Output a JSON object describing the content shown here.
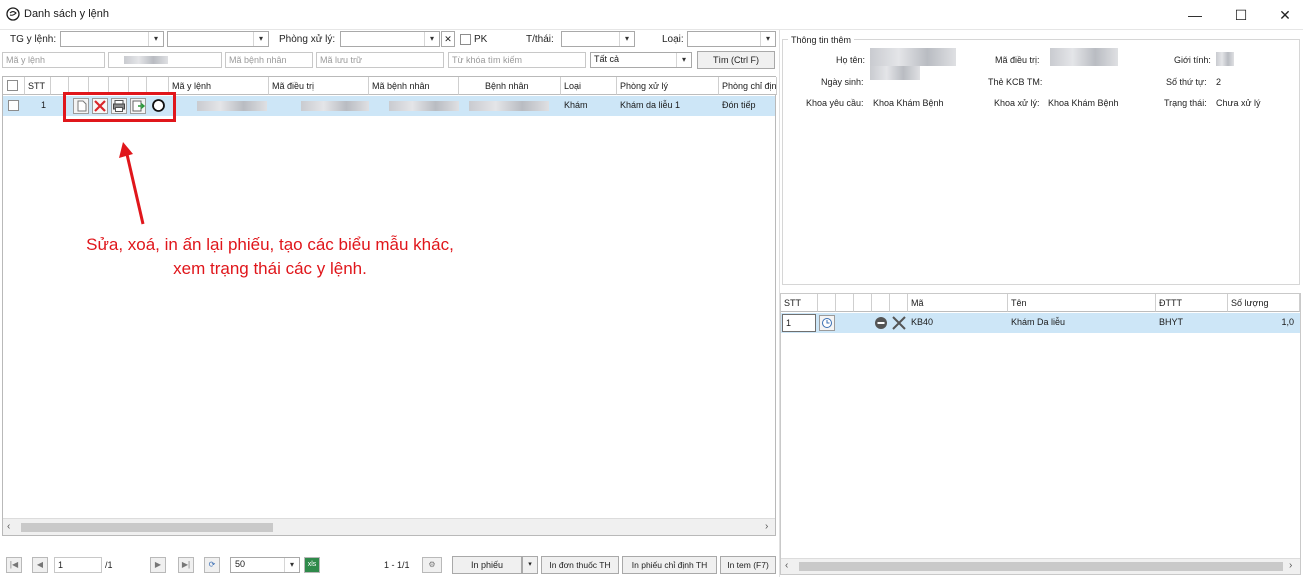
{
  "window": {
    "title": "Danh sách y lệnh",
    "minimize_glyph": "—",
    "maximize_glyph": "☐",
    "close_glyph": "✕"
  },
  "filters": {
    "tg_label": "TG y lệnh:",
    "phong_label": "Phòng xử lý:",
    "pk_label": "PK",
    "tthai_label": "T/thái:",
    "loai_label": "Loại:",
    "clear_glyph": "✕",
    "search_row": {
      "ma_y_lenh": "Mã y lệnh",
      "ma_benh_nhan": "Mã bệnh nhân",
      "ma_luu_tru": "Mã lưu trữ",
      "tu_khoa": "Từ khóa tìm kiếm",
      "status_select": "Tất cả",
      "find_button": "Tìm (Ctrl F)"
    }
  },
  "main_grid": {
    "columns": [
      "STT",
      "Mã y lệnh",
      "Mã điều trị",
      "Mã bệnh nhân",
      "Bệnh nhân",
      "Loại",
      "Phòng xử lý",
      "Phòng chỉ định"
    ],
    "rows": [
      {
        "stt": "1",
        "loai": "Khám",
        "phong_xu_ly": "Khám da liễu 1",
        "phong_chi_dinh": "Đón tiếp"
      }
    ]
  },
  "annotation": {
    "line1": "Sửa, xoá, in ấn lại phiếu, tạo các biểu mẫu khác,",
    "line2": "xem trạng thái các y lệnh.",
    "color": "#e0161b"
  },
  "pager": {
    "page_value": "1",
    "page_total": "/1",
    "page_size": "50",
    "range": "1 - 1/1",
    "in_phieu": "In phiếu",
    "in_don_thuoc": "In đơn thuốc TH",
    "in_phieu_chi_dinh": "In phiếu chỉ định TH",
    "in_tem": "In tem (F7)"
  },
  "info_panel": {
    "legend": "Thông tin thêm",
    "ho_ten_label": "Họ tên:",
    "ma_dieu_tri_label": "Mã điều trị:",
    "gioi_tinh_label": "Giới tính:",
    "ngay_sinh_label": "Ngày sinh:",
    "the_kcb_label": "Thẻ KCB TM:",
    "so_thu_tu_label": "Số thứ tự:",
    "so_thu_tu_value": "2",
    "khoa_yeu_cau_label": "Khoa yêu cầu:",
    "khoa_yeu_cau_value": "Khoa Khám Bệnh",
    "khoa_xu_ly_label": "Khoa xử lý:",
    "khoa_xu_ly_value": "Khoa Khám Bệnh",
    "trang_thai_label": "Trạng thái:",
    "trang_thai_value": "Chưa xử lý"
  },
  "detail_grid": {
    "columns": [
      "STT",
      "Mã",
      "Tên",
      "ĐTTT",
      "Số lượng"
    ],
    "rows": [
      {
        "stt": "1",
        "ma": "KB40",
        "ten": "Khám Da liễu",
        "dttt": "BHYT",
        "so_luong": "1,0"
      }
    ]
  }
}
